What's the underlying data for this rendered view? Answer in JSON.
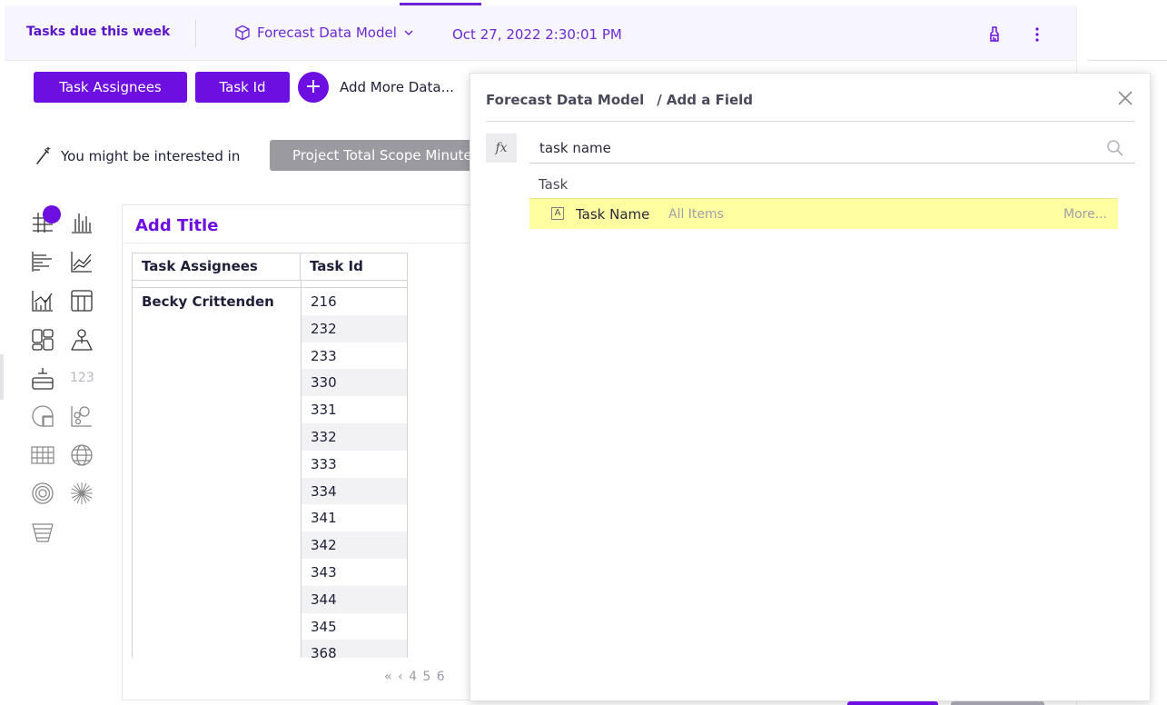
{
  "header": {
    "title": "Tasks due this week",
    "model_label": "Forecast Data Model",
    "datetime": "Oct 27, 2022 2:30:01 PM",
    "accent_color": "#6d0fe0"
  },
  "toolbar": {
    "chips": [
      "Task Assignees",
      "Task Id"
    ],
    "add_more_label": "Add More Data..."
  },
  "suggestions": {
    "label": "You might be interested in",
    "chip": "Project Total Scope Minutes"
  },
  "palette": {
    "count_icon": "123",
    "icons": [
      "pivot-table-icon",
      "column-chart-icon",
      "bar-chart-icon",
      "line-chart-icon",
      "combo-chart-icon",
      "table-icon",
      "kpi-cards-icon",
      "map-pin-icon",
      "single-value-icon",
      "number-icon",
      "pie-chart-icon",
      "scatter-icon",
      "heatmap-icon",
      "globe-icon",
      "radar-icon",
      "sunburst-icon",
      "funnel-icon"
    ]
  },
  "card": {
    "title": "Add Title",
    "columns": [
      "Task Assignees",
      "Task Id"
    ],
    "assignee": "Becky Crittenden",
    "task_ids": [
      "216",
      "232",
      "233",
      "330",
      "331",
      "332",
      "333",
      "334",
      "341",
      "342",
      "343",
      "344",
      "345",
      "368"
    ],
    "pager": "« ‹ 4 5 6"
  },
  "dialog": {
    "breadcrumb_model": "Forecast Data Model",
    "breadcrumb_page": "/ Add a Field",
    "fx_label": "fx",
    "search_value": "task name",
    "group_label": "Task",
    "result": {
      "type_badge": "A",
      "name": "Task Name",
      "scope": "All Items",
      "more": "More..."
    },
    "highlight_color": "#fffea0"
  }
}
